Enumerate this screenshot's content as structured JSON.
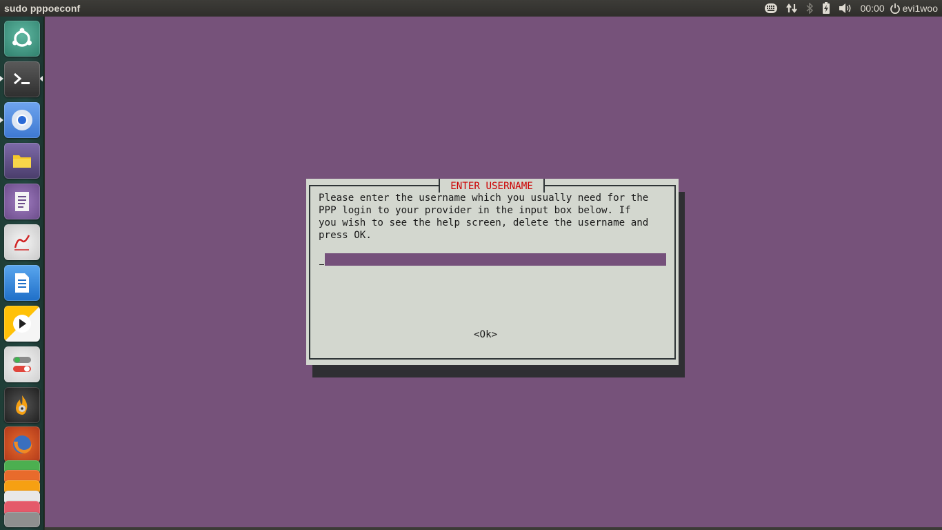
{
  "top_panel": {
    "window_title": "sudo pppoeconf",
    "clock": "00:00",
    "user": "evi1woo",
    "indicators": [
      "keyboard-layout-icon",
      "network-updown-icon",
      "bluetooth-icon",
      "battery-icon",
      "volume-icon",
      "power-icon"
    ]
  },
  "launcher": {
    "items": [
      {
        "name": "ubuntu-dash",
        "icon": "ubuntu-logo-icon",
        "color": "#3f8f7d"
      },
      {
        "name": "terminal",
        "icon": "terminal-icon",
        "color": "#3a3a3a",
        "active": true,
        "focused": true
      },
      {
        "name": "chromium",
        "icon": "chromium-icon",
        "color": "#2b6ad6",
        "active": true
      },
      {
        "name": "files",
        "icon": "folder-icon",
        "color": "#5a4c7a"
      },
      {
        "name": "document-viewer",
        "icon": "document-icon",
        "color": "#7c5a9a"
      },
      {
        "name": "text-editor-red",
        "icon": "pen-icon",
        "color": "#dcdcdc"
      },
      {
        "name": "libreoffice-writer",
        "icon": "writer-icon",
        "color": "#2f7ed8"
      },
      {
        "name": "media-player",
        "icon": "play-icon",
        "color": "#f4b400"
      },
      {
        "name": "settings-toggles",
        "icon": "toggle-icon",
        "color": "#e8e8e8"
      },
      {
        "name": "burner",
        "icon": "flame-disc-icon",
        "color": "#2a2a2a"
      },
      {
        "name": "firefox",
        "icon": "firefox-icon",
        "color": "#d35424"
      }
    ]
  },
  "dialog": {
    "title": "ENTER USERNAME",
    "message": "Please enter the username which you usually need for the\nPPP login to your provider in the input box below. If\nyou wish to see the help screen, delete the username and\npress OK.",
    "input_value": "",
    "ok_label": "<Ok>"
  },
  "colors": {
    "desktop": "#76527a",
    "dialog_bg": "#d3d7cf",
    "dialog_title": "#cc0000",
    "input_bg": "#75507b",
    "shadow": "#2f2f33"
  }
}
